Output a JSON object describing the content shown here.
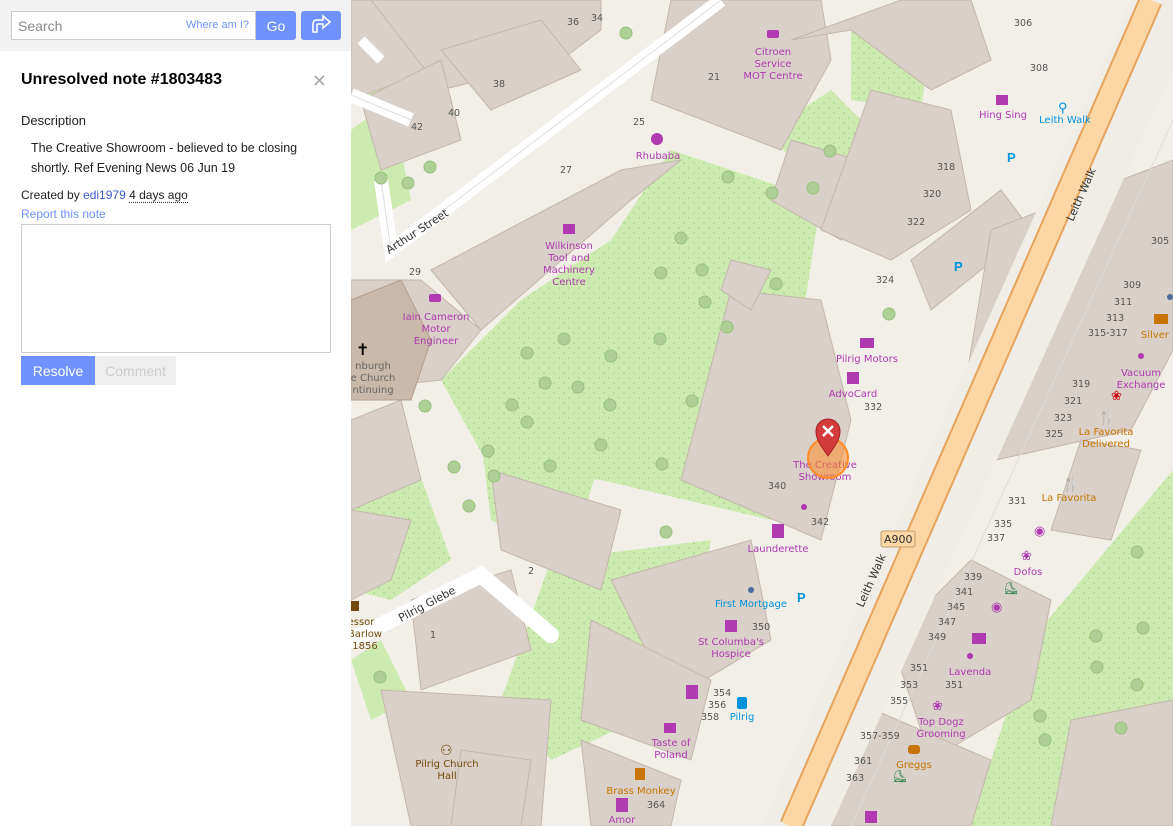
{
  "search": {
    "placeholder": "Search",
    "where_am_i": "Where am I?",
    "go_label": "Go"
  },
  "note": {
    "title": "Unresolved note #1803483",
    "description_heading": "Description",
    "description": "The Creative Showroom - believed to be closing shortly. Ref Evening News 06 Jun 19",
    "created_by_prefix": "Created by ",
    "user": "edi1979",
    "age": "4 days ago",
    "report_label": "Report this note",
    "resolve_label": "Resolve",
    "comment_label": "Comment"
  },
  "map": {
    "streets": {
      "arthur": "Arthur Street",
      "pilrig_glebe": "Pilrig Glebe",
      "leith_walk_1": "Leith Walk",
      "leith_walk_2": "Leith Walk",
      "road_ref": "A900"
    },
    "pois": {
      "citroen": [
        "Citroen",
        "Service",
        "MOT Centre"
      ],
      "rhubaba": "Rhubaba",
      "wilkinson": [
        "Wilkinson",
        "Tool and",
        "Machinery",
        "Centre"
      ],
      "iain": [
        "Iain Cameron",
        "Motor",
        "Engineer"
      ],
      "church": [
        "nburgh",
        "e Church",
        "ntinuing"
      ],
      "pilrig_motors": "Pilrig Motors",
      "advocard": "AdvoCard",
      "creative_showroom": [
        "The Creative",
        "Showroom"
      ],
      "launderette": "Launderette",
      "first_mortgage": "First Mortgage",
      "st_columba": [
        "St Columba's",
        "Hospice"
      ],
      "pilrig_stop": "Pilrig",
      "taste_of_poland": [
        "Taste of",
        "Poland"
      ],
      "brass_monkey": "Brass Monkey",
      "amor": "Amor",
      "pilrig_church_hall": [
        "Pilrig Church",
        "Hall"
      ],
      "hing_sing": "Hing Sing",
      "leith_walk_bikes": "Leith Walk",
      "silver": "Silver Bo",
      "vacuum": [
        "Vacuum",
        "Exchange"
      ],
      "la_favorita_delivered": [
        "La Favorita",
        "Delivered"
      ],
      "la_favorita": "La Favorita",
      "dofos": "Dofos",
      "lavenda": "Lavenda",
      "top_dogz": [
        "Top Dogz",
        "Grooming"
      ],
      "greggs": "Greggs",
      "essor": [
        "essor",
        "Barlow",
        "1856"
      ]
    },
    "house_numbers": [
      "36",
      "34",
      "38",
      "42",
      "40",
      "21",
      "25",
      "27",
      "29",
      "306",
      "308",
      "318",
      "320",
      "322",
      "324",
      "332",
      "340",
      "342",
      "350",
      "354",
      "356",
      "358",
      "364",
      "305",
      "309",
      "311",
      "313",
      "315-317",
      "319",
      "321",
      "323",
      "325",
      "331",
      "335",
      "337",
      "339",
      "341",
      "345",
      "347",
      "349",
      "351",
      "353",
      "351",
      "355",
      "357-359",
      "361",
      "363",
      "2",
      "1"
    ],
    "colors": {
      "grass": "#cdebb0",
      "building": "#d9d0c9",
      "road_major": "#fcd6a4",
      "road_casing": "#e7a45e",
      "note_marker": "#d33a3a",
      "highlight": "#ff8b27"
    }
  }
}
